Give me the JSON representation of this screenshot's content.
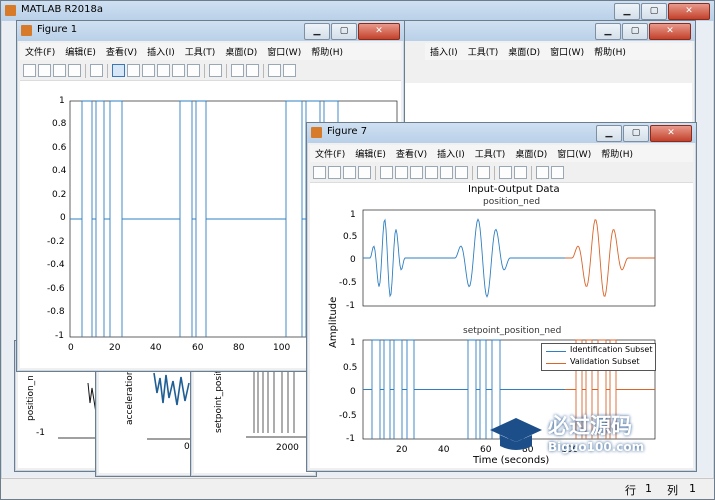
{
  "matlab": {
    "title": "MATLAB R2018a",
    "status_row_label": "行",
    "status_row": "1",
    "status_col_label": "列",
    "status_col": "1"
  },
  "menus": [
    "文件(F)",
    "编辑(E)",
    "查看(V)",
    "插入(I)",
    "工具(T)",
    "桌面(D)",
    "窗口(W)",
    "帮助(H)"
  ],
  "window_controls": {
    "minimize": "▁",
    "maximize": "▢",
    "close": "✕"
  },
  "figure_back": {
    "partial_labels": [
      "position_n",
      "acceleration",
      "setpoint_positio"
    ],
    "tick_labels": [
      "-1",
      "2000",
      "20",
      "0"
    ]
  },
  "figure1": {
    "title": "Figure 1",
    "y_ticks": [
      "1",
      "0.8",
      "0.6",
      "0.4",
      "0.2",
      "0",
      "-0.2",
      "-0.4",
      "-0.6",
      "-0.8",
      "-1"
    ],
    "x_ticks": [
      "0",
      "20",
      "40",
      "60",
      "80",
      "100"
    ]
  },
  "figure7": {
    "title": "Figure 7",
    "chart_data": [
      {
        "type": "line",
        "title": "Input-Output Data",
        "subtitle": "position_ned",
        "ylabel": "Amplitude",
        "ylim": [
          -1.2,
          1.2
        ],
        "y_ticks": [
          "1",
          "0.5",
          "0",
          "-0.5",
          "-1"
        ],
        "series": [
          {
            "name": "Identification Subset",
            "color": "#2f7fc1"
          },
          {
            "name": "Validation Subset",
            "color": "#d9652b"
          }
        ]
      },
      {
        "type": "line",
        "subtitle": "setpoint_position_ned",
        "xlabel": "Time (seconds)",
        "ylim": [
          -1,
          1
        ],
        "y_ticks": [
          "1",
          "0.5",
          "0",
          "-0.5",
          "-1"
        ],
        "x_ticks": [
          "20",
          "40",
          "60",
          "80",
          "100"
        ],
        "legend": [
          "Identification Subset",
          "Validation Subset"
        ],
        "legend_position": "top-right"
      }
    ]
  },
  "watermark": {
    "text": "必过源码",
    "sub": "Biguo100.com"
  }
}
